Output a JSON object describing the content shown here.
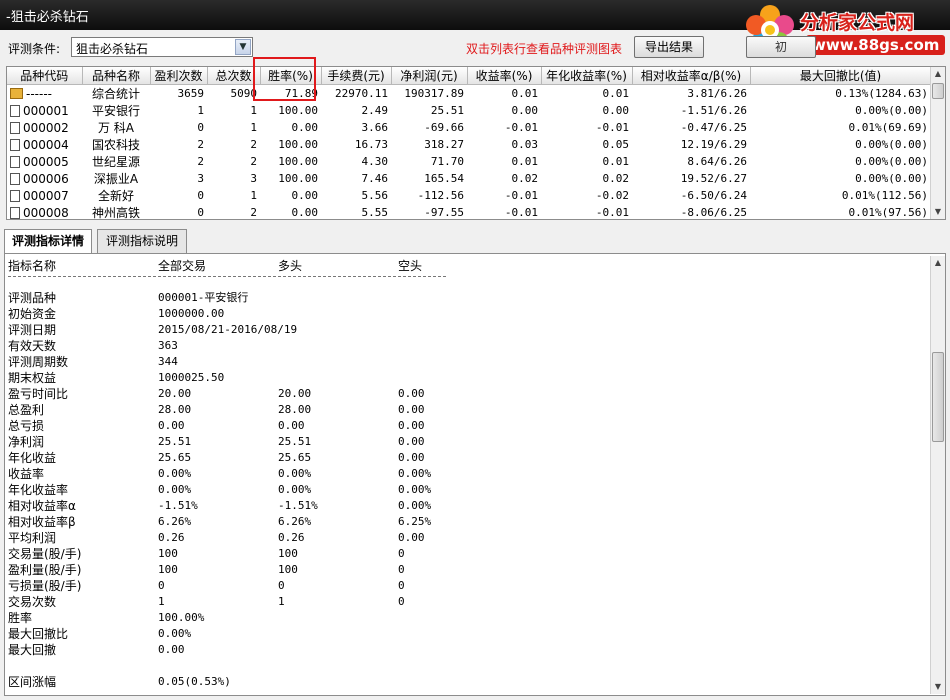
{
  "window": {
    "title": "-狙击必杀钻石"
  },
  "logo": {
    "brand": "分析家公式网",
    "url": "www.88gs.com"
  },
  "toolbar": {
    "condition_label": "评测条件:",
    "condition_value": "狙击必杀钻石",
    "hint": "双击列表行查看品种评测图表",
    "export_label": "导出结果",
    "hidden_button_label": "初"
  },
  "grid": {
    "columns": [
      "品种代码",
      "品种名称",
      "盈利次数",
      "总次数",
      "胜率(%)",
      "手续费(元)",
      "净利润(元)",
      "收益率(%)",
      "年化收益率(%)",
      "相对收益率α/β(%)",
      "最大回撤比(值)"
    ],
    "rows": [
      [
        "------",
        "综合统计",
        "3659",
        "5090",
        "71.89",
        "22970.11",
        "190317.89",
        "0.01",
        "0.01",
        "3.81/6.26",
        "0.13%(1284.63)"
      ],
      [
        "000001",
        "平安银行",
        "1",
        "1",
        "100.00",
        "2.49",
        "25.51",
        "0.00",
        "0.00",
        "-1.51/6.26",
        "0.00%(0.00)"
      ],
      [
        "000002",
        "万 科A",
        "0",
        "1",
        "0.00",
        "3.66",
        "-69.66",
        "-0.01",
        "-0.01",
        "-0.47/6.25",
        "0.01%(69.69)"
      ],
      [
        "000004",
        "国农科技",
        "2",
        "2",
        "100.00",
        "16.73",
        "318.27",
        "0.03",
        "0.05",
        "12.19/6.29",
        "0.00%(0.00)"
      ],
      [
        "000005",
        "世纪星源",
        "2",
        "2",
        "100.00",
        "4.30",
        "71.70",
        "0.01",
        "0.01",
        "8.64/6.26",
        "0.00%(0.00)"
      ],
      [
        "000006",
        "深振业A",
        "3",
        "3",
        "100.00",
        "7.46",
        "165.54",
        "0.02",
        "0.02",
        "19.52/6.27",
        "0.00%(0.00)"
      ],
      [
        "000007",
        "全新好",
        "0",
        "1",
        "0.00",
        "5.56",
        "-112.56",
        "-0.01",
        "-0.02",
        "-6.50/6.24",
        "0.01%(112.56)"
      ],
      [
        "000008",
        "神州高铁",
        "0",
        "2",
        "0.00",
        "5.55",
        "-97.55",
        "-0.01",
        "-0.01",
        "-8.06/6.25",
        "0.01%(97.56)"
      ]
    ]
  },
  "tabs": [
    {
      "label": "评测指标详情",
      "active": true
    },
    {
      "label": "评测指标说明",
      "active": false
    }
  ],
  "detail": {
    "header": [
      "指标名称",
      "全部交易",
      "多头",
      "空头"
    ],
    "rows": [
      [
        "评测品种",
        "000001-平安银行",
        "",
        ""
      ],
      [
        "初始资金",
        "1000000.00",
        "",
        ""
      ],
      [
        "评测日期",
        "2015/08/21-2016/08/19",
        "",
        ""
      ],
      [
        "有效天数",
        "363",
        "",
        ""
      ],
      [
        "评测周期数",
        "344",
        "",
        ""
      ],
      [
        "期末权益",
        "1000025.50",
        "",
        ""
      ],
      [
        "盈亏时间比",
        "20.00",
        "20.00",
        "0.00"
      ],
      [
        "总盈利",
        "28.00",
        "28.00",
        "0.00"
      ],
      [
        "总亏损",
        "0.00",
        "0.00",
        "0.00"
      ],
      [
        "净利润",
        "25.51",
        "25.51",
        "0.00"
      ],
      [
        "年化收益",
        "25.65",
        "25.65",
        "0.00"
      ],
      [
        "收益率",
        "0.00%",
        "0.00%",
        "0.00%"
      ],
      [
        "年化收益率",
        "0.00%",
        "0.00%",
        "0.00%"
      ],
      [
        "相对收益率α",
        "-1.51%",
        "-1.51%",
        "0.00%"
      ],
      [
        "相对收益率β",
        "6.26%",
        "6.26%",
        "6.25%"
      ],
      [
        "平均利润",
        "0.26",
        "0.26",
        "0.00"
      ],
      [
        "交易量(股/手)",
        "100",
        "100",
        "0"
      ],
      [
        "盈利量(股/手)",
        "100",
        "100",
        "0"
      ],
      [
        "亏损量(股/手)",
        "0",
        "0",
        "0"
      ],
      [
        "交易次数",
        "1",
        "1",
        "0"
      ],
      [
        "胜率",
        "100.00%",
        "",
        ""
      ],
      [
        "最大回撤比",
        "0.00%",
        "",
        ""
      ],
      [
        "最大回撤",
        "0.00",
        "",
        ""
      ],
      [
        "",
        "",
        " ",
        ""
      ],
      [
        "区间涨幅",
        "0.05(0.53%)",
        "",
        ""
      ]
    ]
  },
  "colors": {
    "hint": "#e0191b",
    "highlight_box": "#e0191b",
    "brand": "#d8211b"
  }
}
